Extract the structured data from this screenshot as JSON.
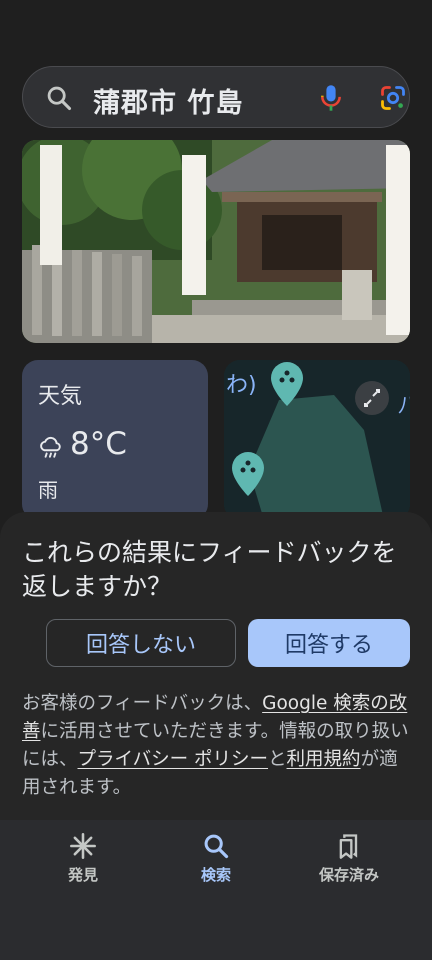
{
  "search": {
    "query": "蒲郡市 竹島"
  },
  "weather": {
    "title": "天気",
    "temperature": "8°C",
    "condition": "雨",
    "icon": "rain-cloud-icon"
  },
  "map": {
    "label": "わ)",
    "label_right": "八"
  },
  "feedback": {
    "question": "これらの結果にフィードバックを返しますか？",
    "no_label": "回答しない",
    "yes_label": "回答する",
    "text_1": "お客様のフィードバックは、",
    "link_improve": "Google 検索の改善",
    "text_2": "に活用させていただきます。情報の取り扱いには、",
    "link_privacy": "プライバシー ポリシー",
    "text_3": "と",
    "link_terms": "利用規約",
    "text_4": "が適用されます。"
  },
  "nav": {
    "items": [
      {
        "label": "発見",
        "icon": "asterisk-icon"
      },
      {
        "label": "検索",
        "icon": "search-icon"
      },
      {
        "label": "保存済み",
        "icon": "bookmarks-icon"
      }
    ],
    "active": "検索"
  },
  "colors": {
    "accent": "#a8c7fa",
    "sheet": "#262626",
    "weather_card": "#3c4358"
  }
}
